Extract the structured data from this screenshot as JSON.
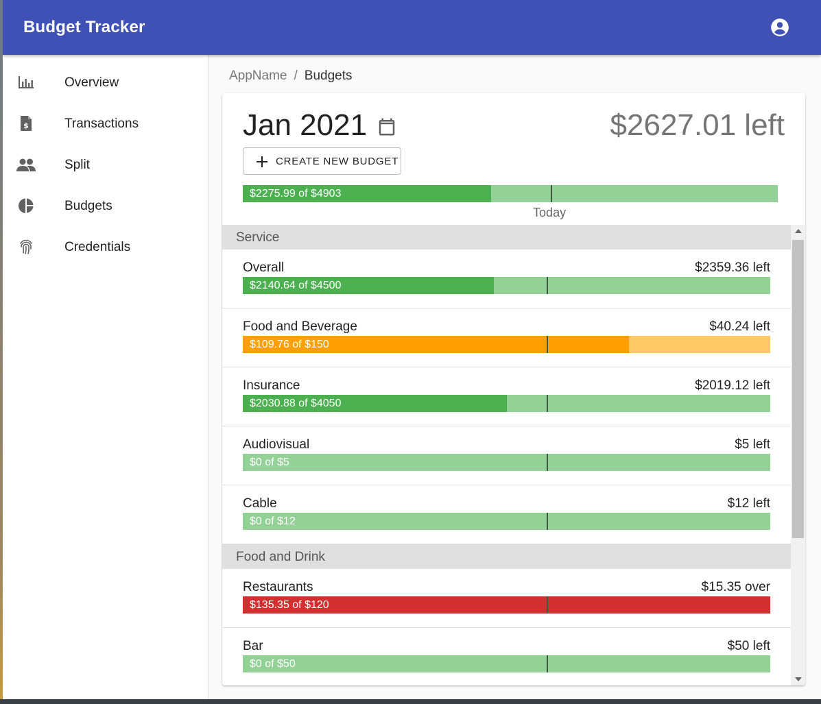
{
  "app": {
    "title": "Budget Tracker"
  },
  "colors": {
    "appbar": "#3f51b5",
    "green_fill": "#4caf50",
    "green_bg": "#94d197",
    "orange_fill": "#ffa000",
    "orange_bg": "#ffca66",
    "red_fill": "#d32f2f",
    "red_bg": "#d32f2f",
    "today_mark": "#3e5a3e"
  },
  "sidebar": {
    "items": [
      {
        "label": "Overview",
        "icon": "bar-chart-icon"
      },
      {
        "label": "Transactions",
        "icon": "receipt-dollar-icon"
      },
      {
        "label": "Split",
        "icon": "people-icon"
      },
      {
        "label": "Budgets",
        "icon": "pie-chart-icon"
      },
      {
        "label": "Credentials",
        "icon": "fingerprint-icon"
      }
    ]
  },
  "breadcrumb": {
    "root": "AppName",
    "separator": "/",
    "current": "Budgets"
  },
  "summary": {
    "month": "Jan 2021",
    "left": "$2627.01 left",
    "create_button": "CREATE NEW BUDGET",
    "bar_text": "$2275.99 of $4903",
    "spent": 2275.99,
    "total": 4903,
    "today_fraction": 0.577,
    "today_label": "Today"
  },
  "groups": [
    {
      "name": "Service",
      "rows": [
        {
          "name": "Overall",
          "status": "$2359.36 left",
          "bar_text": "$2140.64 of $4500",
          "fraction": 0.476,
          "color": "green"
        },
        {
          "name": "Food and Beverage",
          "status": "$40.24 left",
          "bar_text": "$109.76 of $150",
          "fraction": 0.732,
          "color": "orange"
        },
        {
          "name": "Insurance",
          "status": "$2019.12 left",
          "bar_text": "$2030.88 of $4050",
          "fraction": 0.501,
          "color": "green"
        },
        {
          "name": "Audiovisual",
          "status": "$5 left",
          "bar_text": "$0 of $5",
          "fraction": 0,
          "color": "green"
        },
        {
          "name": "Cable",
          "status": "$12 left",
          "bar_text": "$0 of $12",
          "fraction": 0,
          "color": "green"
        }
      ]
    },
    {
      "name": "Food and Drink",
      "rows": [
        {
          "name": "Restaurants",
          "status": "$15.35 over",
          "bar_text": "$135.35 of $120",
          "fraction": 1,
          "color": "red"
        },
        {
          "name": "Bar",
          "status": "$50 left",
          "bar_text": "$0 of $50",
          "fraction": 0,
          "color": "green"
        }
      ]
    }
  ],
  "row_today_fraction": 0.577
}
